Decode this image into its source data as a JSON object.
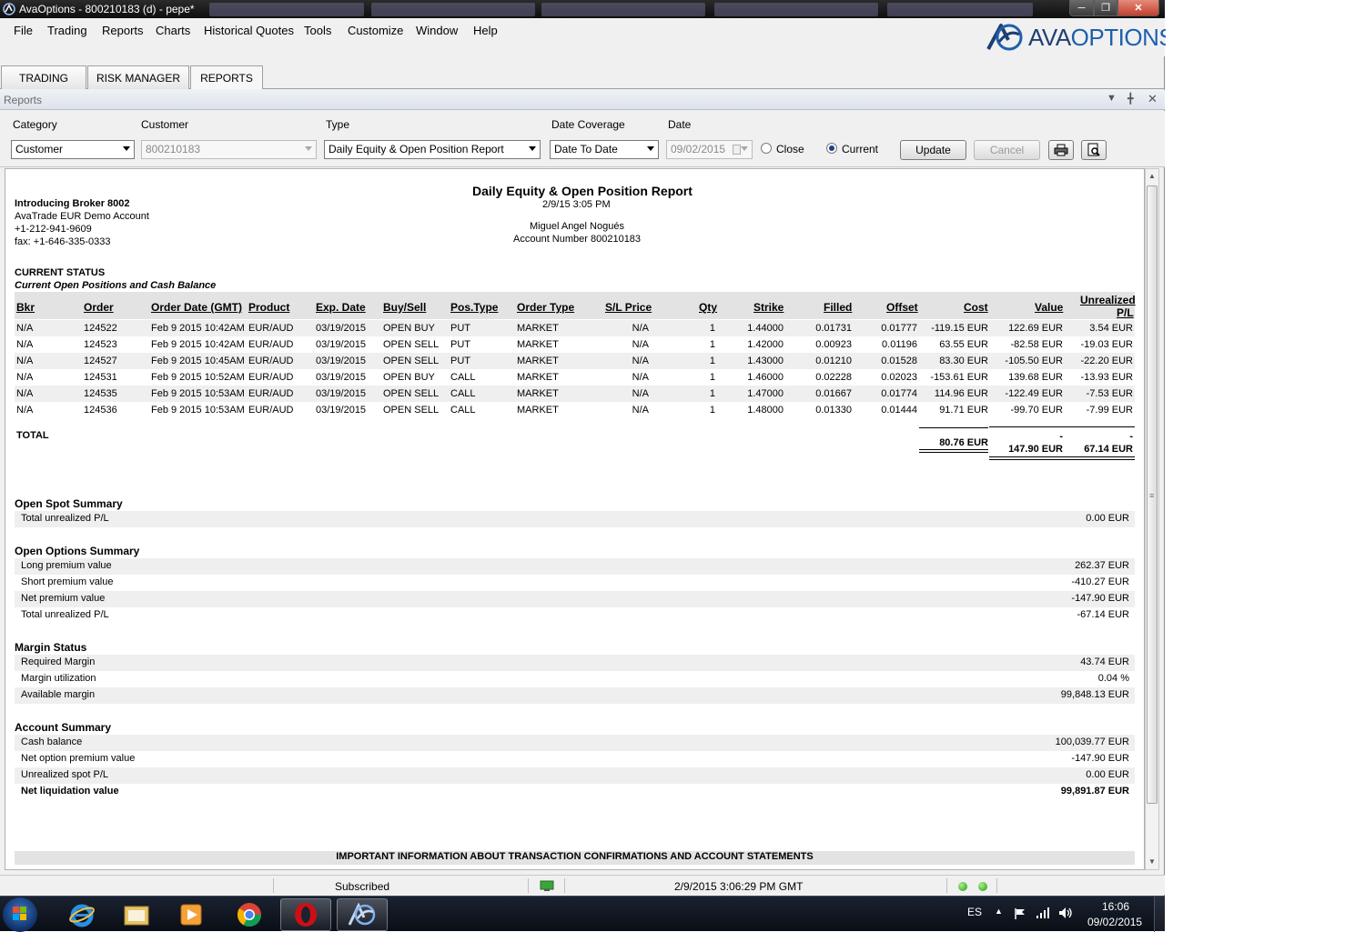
{
  "window": {
    "title": "AvaOptions - 800210183 (d) - pepe*"
  },
  "menu": [
    "File",
    "Trading",
    "Reports",
    "Charts",
    "Historical Quotes",
    "Tools",
    "Customize",
    "Window",
    "Help"
  ],
  "logo": {
    "text_a": "AVA",
    "text_b": "OPTIONS"
  },
  "tabs": [
    "TRADING",
    "RISK MANAGER",
    "REPORTS"
  ],
  "panel": {
    "title": "Reports"
  },
  "filters": {
    "category_label": "Category",
    "category_value": "Customer",
    "customer_label": "Customer",
    "customer_value": "800210183",
    "type_label": "Type",
    "type_value": "Daily Equity & Open Position Report",
    "coverage_label": "Date Coverage",
    "coverage_value": "Date To Date",
    "date_label": "Date",
    "date_value": "09/02/2015",
    "close_label": "Close",
    "current_label": "Current",
    "update_label": "Update",
    "cancel_label": "Cancel"
  },
  "report": {
    "title": "Daily Equity & Open Position Report",
    "datetime": "2/9/15 3:05 PM",
    "client_name": "Miguel Angel Nogués",
    "account_number": "Account Number 800210183",
    "broker": [
      "Introducing Broker 8002",
      "AvaTrade EUR Demo Account",
      "+1-212-941-9609",
      "fax: +1-646-335-0333"
    ],
    "current_status": "CURRENT STATUS",
    "current_sub": "Current Open Positions and Cash Balance",
    "columns": [
      "Bkr",
      "Order",
      "Order Date (GMT)",
      "Product",
      "Exp. Date",
      "Buy/Sell",
      "Pos.Type",
      "Order Type",
      "S/L Price",
      "Qty",
      "Strike",
      "Filled",
      "Offset",
      "Cost",
      "Value",
      "Unrealized",
      "P/L"
    ],
    "rows": [
      [
        "N/A",
        "124522",
        "Feb  9 2015 10:42AM",
        "EUR/AUD",
        "03/19/2015",
        "OPEN BUY",
        "PUT",
        "MARKET",
        "N/A",
        "1",
        "1.44000",
        "0.01731",
        "0.01777",
        "-119.15 EUR",
        "122.69 EUR",
        "3.54 EUR"
      ],
      [
        "N/A",
        "124523",
        "Feb  9 2015 10:42AM",
        "EUR/AUD",
        "03/19/2015",
        "OPEN SELL",
        "PUT",
        "MARKET",
        "N/A",
        "1",
        "1.42000",
        "0.00923",
        "0.01196",
        "63.55 EUR",
        "-82.58 EUR",
        "-19.03 EUR"
      ],
      [
        "N/A",
        "124527",
        "Feb  9 2015 10:45AM",
        "EUR/AUD",
        "03/19/2015",
        "OPEN SELL",
        "PUT",
        "MARKET",
        "N/A",
        "1",
        "1.43000",
        "0.01210",
        "0.01528",
        "83.30 EUR",
        "-105.50 EUR",
        "-22.20 EUR"
      ],
      [
        "N/A",
        "124531",
        "Feb  9 2015 10:52AM",
        "EUR/AUD",
        "03/19/2015",
        "OPEN BUY",
        "CALL",
        "MARKET",
        "N/A",
        "1",
        "1.46000",
        "0.02228",
        "0.02023",
        "-153.61 EUR",
        "139.68 EUR",
        "-13.93 EUR"
      ],
      [
        "N/A",
        "124535",
        "Feb  9 2015 10:53AM",
        "EUR/AUD",
        "03/19/2015",
        "OPEN SELL",
        "CALL",
        "MARKET",
        "N/A",
        "1",
        "1.47000",
        "0.01667",
        "0.01774",
        "114.96 EUR",
        "-122.49 EUR",
        "-7.53 EUR"
      ],
      [
        "N/A",
        "124536",
        "Feb  9 2015 10:53AM",
        "EUR/AUD",
        "03/19/2015",
        "OPEN SELL",
        "CALL",
        "MARKET",
        "N/A",
        "1",
        "1.48000",
        "0.01330",
        "0.01444",
        "91.71 EUR",
        "-99.70 EUR",
        "-7.99 EUR"
      ]
    ],
    "total": {
      "label": "TOTAL",
      "cost": "80.76 EUR",
      "value_dash": "-",
      "value": "147.90 EUR",
      "pl_dash": "-",
      "pl": "67.14 EUR"
    },
    "sections": [
      {
        "title": "Open Spot Summary",
        "items": [
          [
            "Total unrealized P/L",
            "0.00 EUR"
          ]
        ]
      },
      {
        "title": "Open Options Summary",
        "items": [
          [
            "Long premium value",
            "262.37 EUR"
          ],
          [
            "Short premium value",
            "-410.27 EUR"
          ],
          [
            "Net premium value",
            "-147.90 EUR"
          ],
          [
            "Total unrealized P/L",
            "-67.14 EUR"
          ]
        ]
      },
      {
        "title": "Margin Status",
        "items": [
          [
            "Required Margin",
            "43.74 EUR"
          ],
          [
            "Margin utilization",
            "0.04 %"
          ],
          [
            "Available margin",
            "99,848.13 EUR"
          ]
        ]
      },
      {
        "title": "Account Summary",
        "items": [
          [
            "Cash balance",
            "100,039.77 EUR"
          ],
          [
            "Net option premium value",
            "-147.90 EUR"
          ],
          [
            "Unrealized spot P/L",
            "0.00 EUR"
          ],
          [
            "Net liquidation value",
            "99,891.87 EUR"
          ]
        ]
      }
    ],
    "important": "IMPORTANT INFORMATION ABOUT TRANSACTION CONFIRMATIONS AND ACCOUNT STATEMENTS"
  },
  "status": {
    "subscription": "Subscribed",
    "timestamp": "2/9/2015 3:06:29 PM  GMT"
  },
  "taskbar": {
    "lang": "ES",
    "time": "16:06",
    "date": "09/02/2015"
  },
  "colors": {
    "brand": "#1e5fae",
    "dark_brand": "#1f3f73",
    "header_bg": "#e3e3e3",
    "row_alt": "#efefef"
  }
}
